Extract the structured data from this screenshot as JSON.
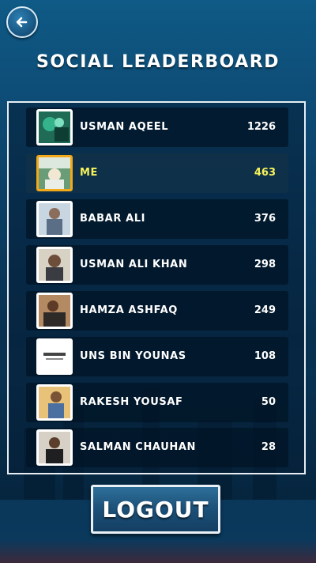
{
  "title": "SOCIAL LEADERBOARD",
  "entries": [
    {
      "name": "USMAN AQEEL",
      "score": "1226",
      "is_me": false,
      "avatar": "avatar-usman-aqeel"
    },
    {
      "name": "ME",
      "score": "463",
      "is_me": true,
      "avatar": "avatar-me"
    },
    {
      "name": "BABAR ALI",
      "score": "376",
      "is_me": false,
      "avatar": "avatar-babar-ali"
    },
    {
      "name": "USMAN ALI KHAN",
      "score": "298",
      "is_me": false,
      "avatar": "avatar-usman-ali-khan"
    },
    {
      "name": "HAMZA ASHFAQ",
      "score": "249",
      "is_me": false,
      "avatar": "avatar-hamza-ashfaq"
    },
    {
      "name": "UNS BIN YOUNAS",
      "score": "108",
      "is_me": false,
      "avatar": "avatar-uns-bin-younas"
    },
    {
      "name": "RAKESH YOUSAF",
      "score": "50",
      "is_me": false,
      "avatar": "avatar-rakesh-yousaf"
    },
    {
      "name": "SALMAN CHAUHAN",
      "score": "28",
      "is_me": false,
      "avatar": "avatar-salman-chauhan"
    }
  ],
  "logout_label": "LOGOUT",
  "icons": {
    "back": "back-arrow-icon"
  },
  "colors": {
    "me_highlight": "#f7f25a",
    "me_avatar_border": "#f2a91c",
    "panel_border": "#e6eef4"
  }
}
